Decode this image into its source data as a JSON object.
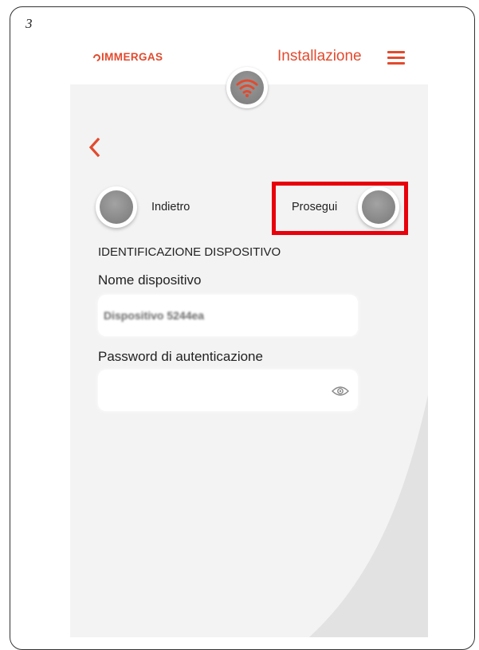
{
  "step_number": "3",
  "header": {
    "logo_text": "IMMERGAS",
    "title": "Installazione",
    "menu_icon": "hamburger-menu-icon"
  },
  "status_icon": "wifi-icon",
  "nav": {
    "back_icon": "chevron-left-icon",
    "back_label": "Indietro",
    "next_label": "Prosegui"
  },
  "form": {
    "section_title": "IDENTIFICAZIONE DISPOSITIVO",
    "device_name_label": "Nome dispositivo",
    "device_name_value": "Dispositivo 5244ea",
    "password_label": "Password di autenticazione",
    "password_value": "",
    "password_toggle_icon": "eye-icon"
  },
  "colors": {
    "accent": "#e24a2e",
    "highlight": "#e8000b",
    "background": "#efefef"
  }
}
